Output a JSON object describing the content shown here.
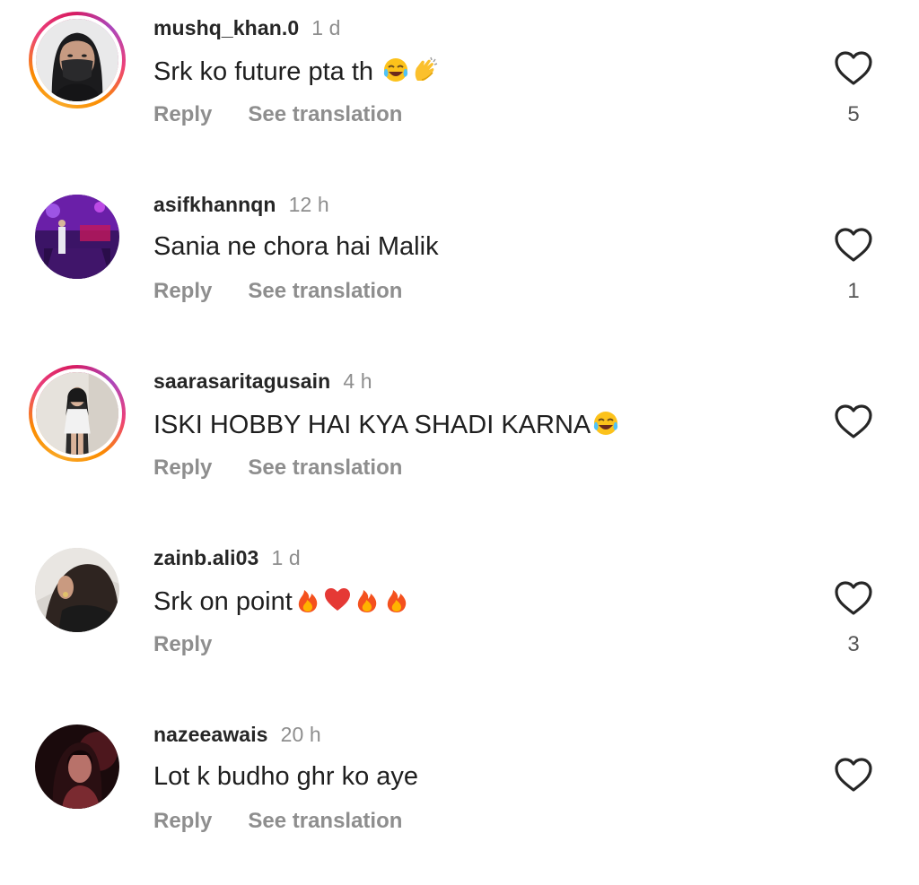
{
  "comments": [
    {
      "username": "mushq_khan.0",
      "time": "1 d",
      "text": "Srk ko future pta th ",
      "emojis": [
        "tears-of-joy",
        "clapping-hands"
      ],
      "reply_label": "Reply",
      "translate_label": "See translation",
      "likes": "5",
      "has_story": true
    },
    {
      "username": "asifkhannqn",
      "time": "12 h",
      "text": "Sania ne chora hai Malik",
      "emojis": [],
      "reply_label": "Reply",
      "translate_label": "See translation",
      "likes": "1",
      "has_story": false
    },
    {
      "username": "saarasaritagusain",
      "time": "4 h",
      "text": "ISKI HOBBY HAI KYA SHADI KARNA",
      "emojis": [
        "tears-of-joy"
      ],
      "reply_label": "Reply",
      "translate_label": "See translation",
      "likes": "",
      "has_story": true
    },
    {
      "username": "zainb.ali03",
      "time": "1 d",
      "text": "Srk on point",
      "emojis": [
        "fire",
        "red-heart",
        "fire",
        "fire"
      ],
      "reply_label": "Reply",
      "translate_label": "",
      "likes": "3",
      "has_story": false
    },
    {
      "username": "nazeeawais",
      "time": "20 h",
      "text": "Lot k budho ghr ko aye",
      "emojis": [],
      "reply_label": "Reply",
      "translate_label": "See translation",
      "likes": "",
      "has_story": false
    }
  ],
  "colors": {
    "username": "#262626",
    "secondary": "#8e8e8e",
    "story_ring": "#ec407a"
  }
}
